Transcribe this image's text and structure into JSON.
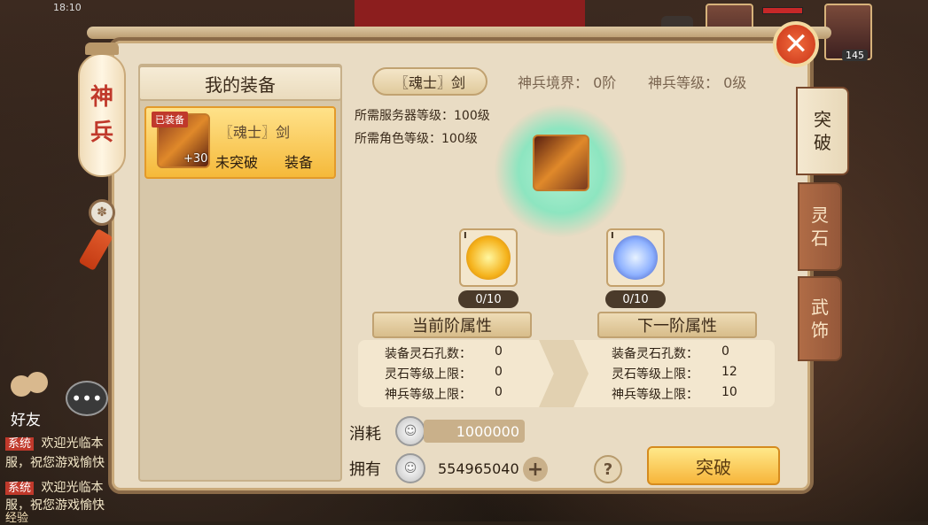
{
  "status_bar": {
    "time": "18:10"
  },
  "hud": {
    "player_level": "145"
  },
  "lantern": {
    "chars": [
      "神",
      "兵"
    ]
  },
  "left_panel": {
    "title": "我的装备",
    "items": [
      {
        "tag": "已装备",
        "plus": "+30",
        "name": "〖魂士〗剑",
        "state": "未突破",
        "action": "装备"
      }
    ]
  },
  "detail": {
    "name": "〖魂士〗剑",
    "realm_label": "神兵境界：",
    "realm_value": "0阶",
    "level_label": "神兵等级：",
    "level_value": "0级",
    "req_server": "所需服务器等级：100级",
    "req_role": "所需角色等级：100级",
    "current_stone": {
      "roman": "I",
      "count": "0/10"
    },
    "next_stone": {
      "roman": "I",
      "count": "0/10"
    },
    "current_attr_title": "当前阶属性",
    "next_attr_title": "下一阶属性",
    "current_attrs": [
      {
        "label": "装备灵石孔数：",
        "value": "0"
      },
      {
        "label": "灵石等级上限：",
        "value": "0"
      },
      {
        "label": "神兵等级上限：",
        "value": "0"
      }
    ],
    "next_attrs": [
      {
        "label": "装备灵石孔数：",
        "value": "0"
      },
      {
        "label": "灵石等级上限：",
        "value": "12"
      },
      {
        "label": "神兵等级上限：",
        "value": "10"
      }
    ]
  },
  "cost": {
    "cost_label": "消耗",
    "cost_value": "1000000",
    "own_label": "拥有",
    "own_value": "554965040"
  },
  "buttons": {
    "help": "?",
    "breakthrough": "突破",
    "close": "✕",
    "plus": "+"
  },
  "side_tabs": [
    {
      "label": [
        "突",
        "破"
      ],
      "active": true
    },
    {
      "label": [
        "灵",
        "石"
      ],
      "active": false
    },
    {
      "label": [
        "武",
        "饰"
      ],
      "active": false
    }
  ],
  "chat": {
    "friend_label": "好友",
    "lines": [
      {
        "badge": "系统",
        "text": "欢迎光临本"
      },
      {
        "badge": "",
        "text": "服，祝您游戏愉快"
      },
      {
        "badge": "系统",
        "text": "欢迎光临本"
      },
      {
        "badge": "",
        "text": "服，祝您游戏愉快"
      }
    ],
    "exp_label": "经验"
  }
}
